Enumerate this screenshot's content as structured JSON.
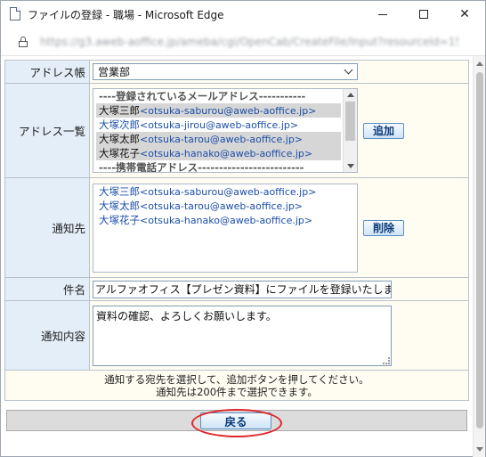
{
  "window": {
    "title": "ファイルの登録 - 職場 - Microsoft Edge",
    "url": "https://g3.aweb-aoffice.jp/ameba/cgi/OpenCab/CreateFile/Input?resourceId=15...",
    "minimize_label": "",
    "maximize_label": "",
    "close_label": "✕"
  },
  "form": {
    "address_book": {
      "label": "アドレス帳",
      "selected": "営業部"
    },
    "address_list": {
      "label": "アドレス一覧",
      "items": [
        {
          "type": "sep",
          "text": "----登録されているメールアドレス-----------"
        },
        {
          "type": "item",
          "selected": true,
          "name": "大塚三郎",
          "email": "<otsuka-saburou@aweb-aoffice.jp>"
        },
        {
          "type": "item",
          "selected": false,
          "name": "大塚次郎",
          "email": "<otsuka-jirou@aweb-aoffice.jp>"
        },
        {
          "type": "item",
          "selected": true,
          "name": "大塚太郎",
          "email": "<otsuka-tarou@aweb-aoffice.jp>"
        },
        {
          "type": "item",
          "selected": true,
          "name": "大塚花子",
          "email": "<otsuka-hanako@aweb-aoffice.jp>"
        },
        {
          "type": "sep",
          "text": "----携帯電話アドレス-------------------------"
        }
      ],
      "add_button": "追加"
    },
    "recipients": {
      "label": "通知先",
      "items": [
        {
          "name": "大塚三郎",
          "email": "<otsuka-saburou@aweb-aoffice.jp>"
        },
        {
          "name": "大塚太郎",
          "email": "<otsuka-tarou@aweb-aoffice.jp>"
        },
        {
          "name": "大塚花子",
          "email": "<otsuka-hanako@aweb-aoffice.jp>"
        }
      ],
      "remove_button": "削除"
    },
    "subject": {
      "label": "件名",
      "value": "アルファオフィス【プレゼン資料】にファイルを登録いたしました"
    },
    "message": {
      "label": "通知内容",
      "value": "資料の確認、よろしくお願いします。"
    },
    "note_line1": "通知する宛先を選択して、追加ボタンを押してください。",
    "note_line2": "通知先は200件まで選択できます。"
  },
  "footer": {
    "back_button": "戻る"
  },
  "colors": {
    "label_bg": "#e4eef8",
    "value_bg": "#fffdf2",
    "highlight": "#e0262b"
  }
}
